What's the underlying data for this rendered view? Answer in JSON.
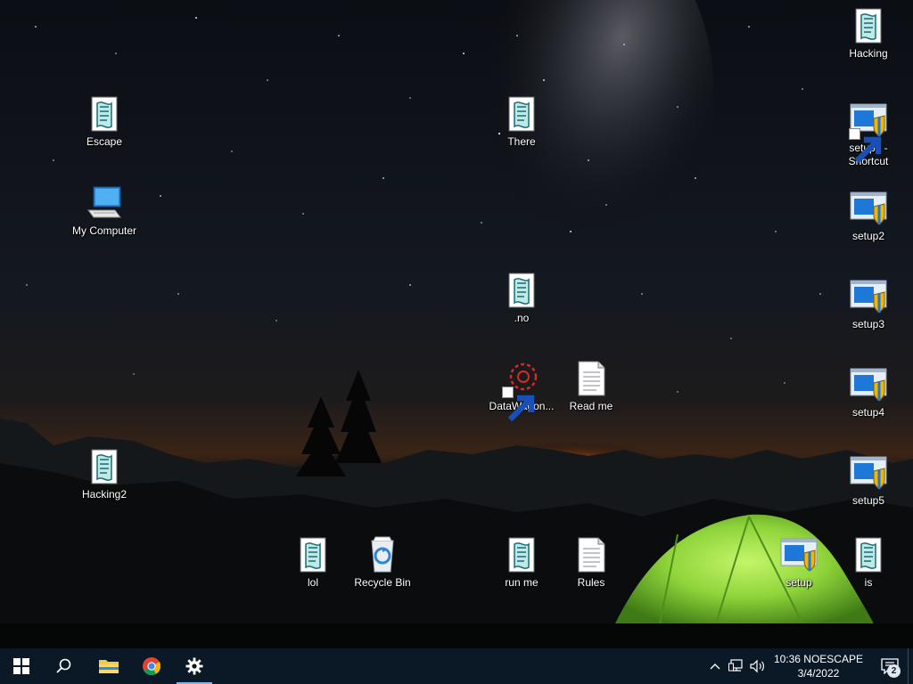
{
  "desktop": {
    "icons": [
      {
        "label": "Escape",
        "type": "script"
      },
      {
        "label": "My Computer",
        "type": "computer"
      },
      {
        "label": "Hacking2",
        "type": "script"
      },
      {
        "label": "There",
        "type": "script"
      },
      {
        "label": ".no",
        "type": "script"
      },
      {
        "label": "DataWagon...",
        "type": "shortcut-app"
      },
      {
        "label": "Read me",
        "type": "text-document"
      },
      {
        "label": "lol",
        "type": "script"
      },
      {
        "label": "Recycle Bin",
        "type": "recycle-bin"
      },
      {
        "label": "run me",
        "type": "script"
      },
      {
        "label": "Rules",
        "type": "text-document"
      },
      {
        "label": "setup",
        "type": "installer"
      },
      {
        "label": "is",
        "type": "script"
      },
      {
        "label": "Hacking",
        "type": "script"
      },
      {
        "label": "setup2 - Shortcut",
        "type": "installer-shortcut"
      },
      {
        "label": "setup2",
        "type": "installer"
      },
      {
        "label": "setup3",
        "type": "installer"
      },
      {
        "label": "setup4",
        "type": "installer"
      },
      {
        "label": "setup5",
        "type": "installer"
      }
    ]
  },
  "taskbar": {
    "buttons": [
      {
        "name": "start",
        "icon": "windows-logo-icon"
      },
      {
        "name": "search",
        "icon": "search-icon"
      },
      {
        "name": "file-explorer",
        "icon": "folder-icon"
      },
      {
        "name": "chrome",
        "icon": "chrome-icon"
      },
      {
        "name": "settings",
        "icon": "gear-icon",
        "active": true
      }
    ],
    "tray": {
      "icons": [
        "chevron-up-icon",
        "network-icon",
        "volume-icon"
      ],
      "clock_line1": "10:36 NOESCAPE",
      "clock_line2": "3/4/2022",
      "notification_count": "2"
    }
  },
  "colors": {
    "taskbar_bg": "#0b1826",
    "tent_green": "#8fd43a",
    "horizon_orange": "#e0701c",
    "installer_blue": "#1e78d7",
    "shield_yellow": "#f2b705"
  }
}
